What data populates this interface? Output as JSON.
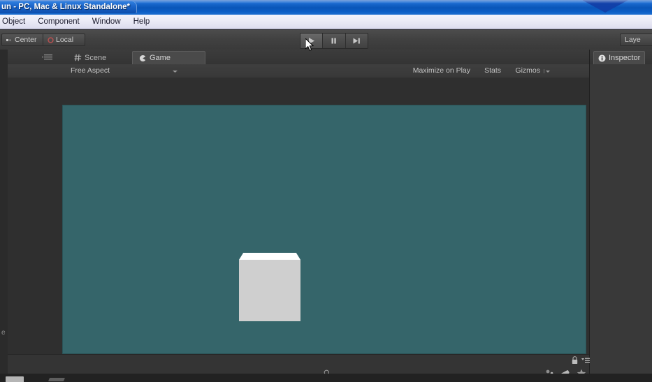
{
  "window": {
    "title": "un - PC, Mac & Linux Standalone*"
  },
  "menubar": {
    "items": [
      {
        "label": "Object",
        "name": "menu-object"
      },
      {
        "label": "Component",
        "name": "menu-component"
      },
      {
        "label": "Window",
        "name": "menu-window"
      },
      {
        "label": "Help",
        "name": "menu-help"
      }
    ]
  },
  "toolbar": {
    "pivot_mode": "Center",
    "pivot_rotation": "Local",
    "play_label": "Play",
    "pause_label": "Pause",
    "step_label": "Step",
    "layers_label": "Laye",
    "cursor_over": "play-button"
  },
  "game_dock": {
    "tabs": [
      {
        "label": "Scene",
        "icon": "scene-icon",
        "active": false
      },
      {
        "label": "Game",
        "icon": "game-icon",
        "active": true
      }
    ],
    "view_toolbar": {
      "aspect": "Free Aspect",
      "maximize_on_play": "Maximize on Play",
      "stats": "Stats",
      "gizmos": "Gizmos"
    },
    "viewport": {
      "background_color": "#35656a",
      "object_top_color": "#ffffff",
      "object_front_color": "#cfcfcf"
    },
    "search": {
      "value": "",
      "placeholder": ""
    }
  },
  "inspector": {
    "tab_label": "Inspector",
    "tab_icon": "info-icon"
  },
  "left_gutter": {
    "label": "e"
  },
  "colors": {
    "titlebar_blue": "#0d55b8",
    "menubar": "#e8e8f4",
    "toolbar": "#414141",
    "panel": "#393939",
    "viewport_teal": "#35656a"
  }
}
